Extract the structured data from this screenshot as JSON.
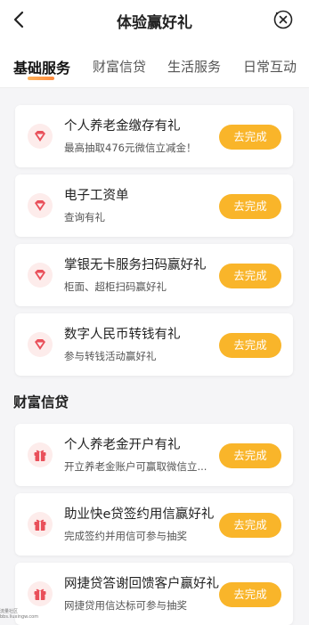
{
  "header": {
    "title": "体验赢好礼",
    "back_icon": "chevron-left-icon",
    "close_icon": "close-circle-icon"
  },
  "tabs": [
    {
      "label": "基础服务",
      "active": true
    },
    {
      "label": "财富信贷",
      "active": false
    },
    {
      "label": "生活服务",
      "active": false
    },
    {
      "label": "日常互动",
      "active": false
    }
  ],
  "basic_services": [
    {
      "title": "个人养老金缴存有礼",
      "subtitle": "最高抽取476元微信立减金！",
      "button": "去完成",
      "icon": "diamond-icon"
    },
    {
      "title": "电子工资单",
      "subtitle": "查询有礼",
      "button": "去完成",
      "icon": "diamond-icon"
    },
    {
      "title": "掌银无卡服务扫码赢好礼",
      "subtitle": "柜面、超柜扫码赢好礼",
      "button": "去完成",
      "icon": "diamond-icon"
    },
    {
      "title": "数字人民币转钱有礼",
      "subtitle": "参与转钱活动赢好礼",
      "button": "去完成",
      "icon": "diamond-icon"
    }
  ],
  "wealth_section": {
    "title": "财富信贷",
    "items": [
      {
        "title": "个人养老金开户有礼",
        "subtitle": "开立养老金账户可赢取微信立...",
        "button": "去完成",
        "icon": "gift-icon"
      },
      {
        "title": "助业快e贷签约用信赢好礼",
        "subtitle": "完成签约并用信可参与抽奖",
        "button": "去完成",
        "icon": "gift-icon"
      },
      {
        "title": "网捷贷答谢回馈客户赢好礼",
        "subtitle": "网捷贷用信达标可参与抽奖",
        "button": "去完成",
        "icon": "gift-icon"
      }
    ]
  },
  "watermark": {
    "line1": "流量社区",
    "line2": "bbs.liuxingw.com"
  },
  "colors": {
    "accent": "#f9b52a",
    "icon_red": "#e9505a",
    "icon_bg": "#fdeceb",
    "tab_underline": "#ff9a4a"
  }
}
